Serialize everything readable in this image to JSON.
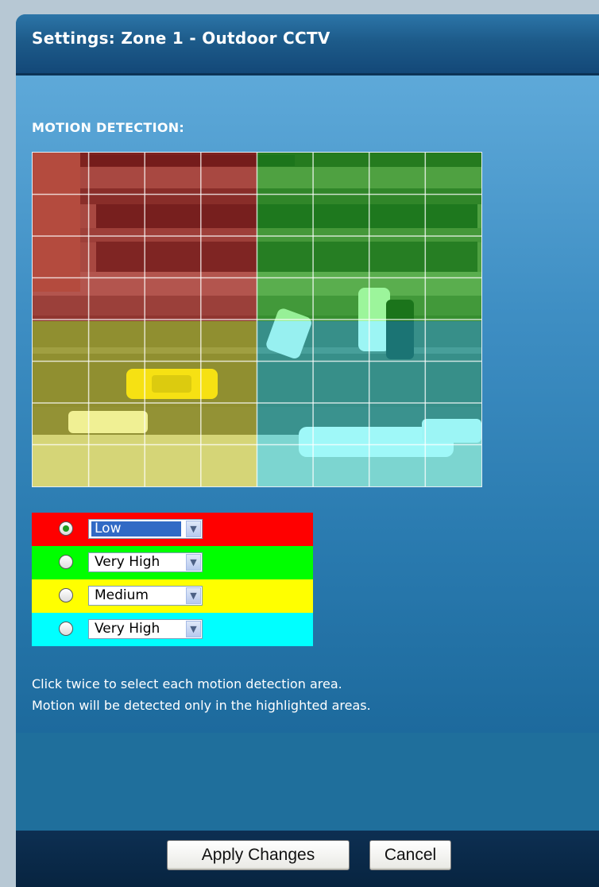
{
  "header": {
    "title": "Settings: Zone 1 - Outdoor CCTV"
  },
  "section": {
    "title": "MOTION DETECTION:"
  },
  "zones": [
    {
      "color": "#ff0000",
      "selected": true,
      "sensitivity": "Low"
    },
    {
      "color": "#00ff00",
      "selected": false,
      "sensitivity": "Very High"
    },
    {
      "color": "#ffff00",
      "selected": false,
      "sensitivity": "Medium"
    },
    {
      "color": "#00ffff",
      "selected": false,
      "sensitivity": "Very High"
    }
  ],
  "help": {
    "line1": "Click twice to select each motion detection area.",
    "line2": "Motion will be detected only in the highlighted areas."
  },
  "buttons": {
    "apply": "Apply Changes",
    "cancel": "Cancel"
  },
  "colors": {
    "zone_red": "#ff0000",
    "zone_green": "#00ff00",
    "zone_yellow": "#ffff00",
    "zone_cyan": "#00ffff"
  }
}
